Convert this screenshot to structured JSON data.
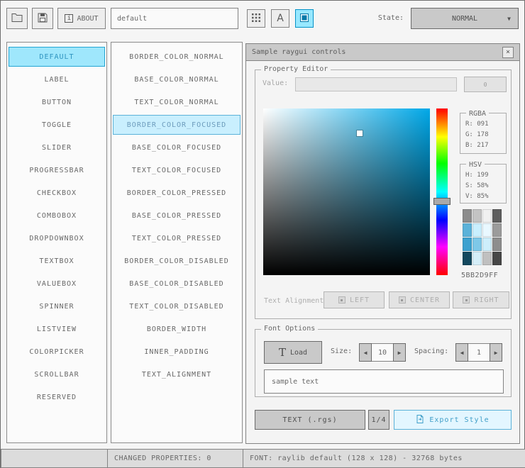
{
  "toolbar": {
    "style_name_value": "default",
    "about_label": "ABOUT",
    "state_label": "State:",
    "state_value": "NORMAL"
  },
  "icons": {
    "about": "i",
    "font": "A",
    "close": "×",
    "dropdown": "▼",
    "spin_left": "◀",
    "spin_right": "▶",
    "load_font": "T"
  },
  "controls_list": [
    "DEFAULT",
    "LABEL",
    "BUTTON",
    "TOGGLE",
    "SLIDER",
    "PROGRESSBAR",
    "CHECKBOX",
    "COMBOBOX",
    "DROPDOWNBOX",
    "TEXTBOX",
    "VALUEBOX",
    "SPINNER",
    "LISTVIEW",
    "COLORPICKER",
    "SCROLLBAR",
    "RESERVED"
  ],
  "controls_selected": 0,
  "properties_list": [
    "BORDER_COLOR_NORMAL",
    "BASE_COLOR_NORMAL",
    "TEXT_COLOR_NORMAL",
    "BORDER_COLOR_FOCUSED",
    "BASE_COLOR_FOCUSED",
    "TEXT_COLOR_FOCUSED",
    "BORDER_COLOR_PRESSED",
    "BASE_COLOR_PRESSED",
    "TEXT_COLOR_PRESSED",
    "BORDER_COLOR_DISABLED",
    "BASE_COLOR_DISABLED",
    "TEXT_COLOR_DISABLED",
    "BORDER_WIDTH",
    "INNER_PADDING",
    "TEXT_ALIGNMENT"
  ],
  "properties_selected": 3,
  "window": {
    "title": "Sample raygui controls"
  },
  "property_editor": {
    "title": "Property Editor",
    "value_label": "Value:",
    "value_text": "",
    "value_button_label": "0",
    "rgba_title": "RGBA",
    "rgba_r": "R: 091",
    "rgba_g": "G: 178",
    "rgba_b": "B: 217",
    "hsv_title": "HSV",
    "hsv_h": "H: 199",
    "hsv_s": "S: 58%",
    "hsv_v": "V: 85%",
    "hex_value": "5BB2D9FF",
    "alignment_label": "Text Alignment:",
    "align_left": "LEFT",
    "align_center": "CENTER",
    "align_right": "RIGHT"
  },
  "swatch_colors": [
    "#8c8c8c",
    "#c3c3c3",
    "#f0f0f0",
    "#5e5e5e",
    "#5bb2d9",
    "#c9effe",
    "#e9f8ff",
    "#9b9b9b",
    "#3ba1cf",
    "#7ec8e8",
    "#cdeefb",
    "#8d8d8d",
    "#14485e",
    "#d5eef8",
    "#c0c0c0",
    "#474747"
  ],
  "font_options": {
    "title": "Font Options",
    "load_label": "Load",
    "size_label": "Size:",
    "size_value": "10",
    "spacing_label": "Spacing:",
    "spacing_value": "1",
    "sample_text": "sample text"
  },
  "footer_buttons": {
    "export_format": "TEXT (.rgs)",
    "page": "1/4",
    "export_label": "Export Style"
  },
  "statusbar": {
    "left": "",
    "changed": "CHANGED PROPERTIES: 0",
    "font_info": "FONT: raylib default (128 x 128) - 32768 bytes"
  },
  "colors": {
    "accent_border": "#5bb2d9",
    "accent_fill": "#c9effe",
    "accent_text": "#6c9bbc",
    "active_border": "#0492c7",
    "active_fill": "#97e8ff",
    "picker_hue": "#00a8e8",
    "text": "#686868",
    "border": "#838383",
    "disabled_text": "#aeaeae"
  }
}
